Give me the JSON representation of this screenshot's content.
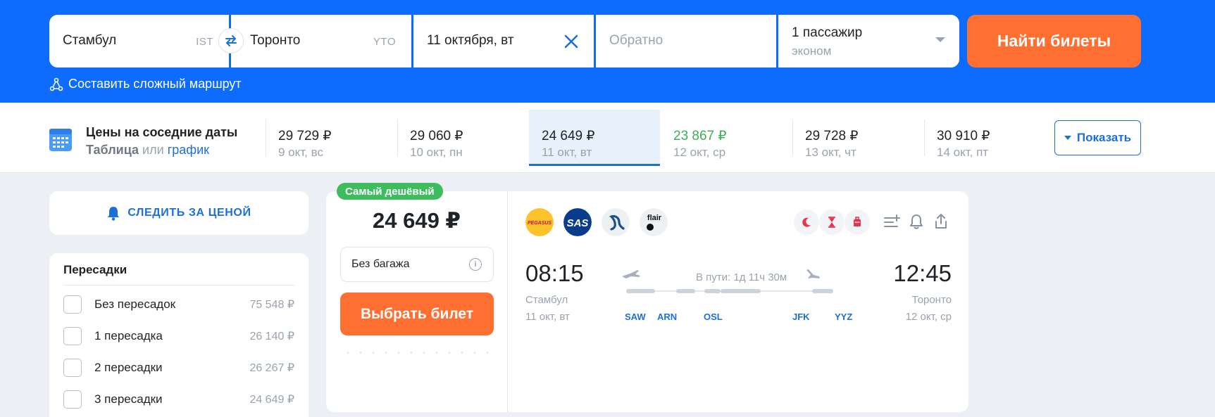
{
  "search": {
    "origin": {
      "city": "Стамбул",
      "code": "IST"
    },
    "destination": {
      "city": "Торонто",
      "code": "YTO"
    },
    "depart_date": "11 октября, вт",
    "return_placeholder": "Обратно",
    "passengers": "1 пассажир",
    "cabin": "эконом",
    "submit_label": "Найти билеты",
    "complex_route_label": "Составить сложный маршрут"
  },
  "nearby_dates": {
    "title": "Цены на соседние даты",
    "table_link": "Таблица",
    "or_text": "или",
    "chart_link": "график",
    "items": [
      {
        "price": "29 729 ₽",
        "day": "9 окт, вс"
      },
      {
        "price": "29 060 ₽",
        "day": "10 окт, пн"
      },
      {
        "price": "24 649 ₽",
        "day": "11 окт, вт"
      },
      {
        "price": "23 867 ₽",
        "day": "12 окт, ср"
      },
      {
        "price": "29 728 ₽",
        "day": "13 окт, чт"
      },
      {
        "price": "30 910 ₽",
        "day": "14 окт, пт"
      }
    ],
    "show_label": "Показать"
  },
  "watch_price_label": "СЛЕДИТЬ ЗА ЦЕНОЙ",
  "filters": {
    "title": "Пересадки",
    "options": [
      {
        "label": "Без пересадок",
        "price": "75 548 ₽"
      },
      {
        "label": "1 пересадка",
        "price": "26 140 ₽"
      },
      {
        "label": "2 пересадки",
        "price": "26 267 ₽"
      },
      {
        "label": "3 пересадки",
        "price": "24 649 ₽"
      }
    ]
  },
  "ticket": {
    "badge": "Самый дешёвый",
    "price": "24 649 ₽",
    "baggage": "Без багажа",
    "choose_label": "Выбрать билет",
    "airlines": {
      "pegasus": "PEGASUS",
      "sas": "SAS",
      "flair": "flair"
    },
    "departure": {
      "time": "08:15",
      "city": "Стамбул",
      "date": "11 окт, вт"
    },
    "arrival": {
      "time": "12:45",
      "city": "Торонто",
      "date": "12 окт, ср"
    },
    "duration": "В пути: 1д 11ч 30м",
    "stops": [
      "SAW",
      "ARN",
      "OSL",
      "JFK",
      "YYZ"
    ]
  },
  "colors": {
    "brand_blue": "#0d6bfd",
    "accent_orange": "#ff6f32",
    "link_blue": "#1d6fd8",
    "cheap_green": "#3fae5a"
  }
}
